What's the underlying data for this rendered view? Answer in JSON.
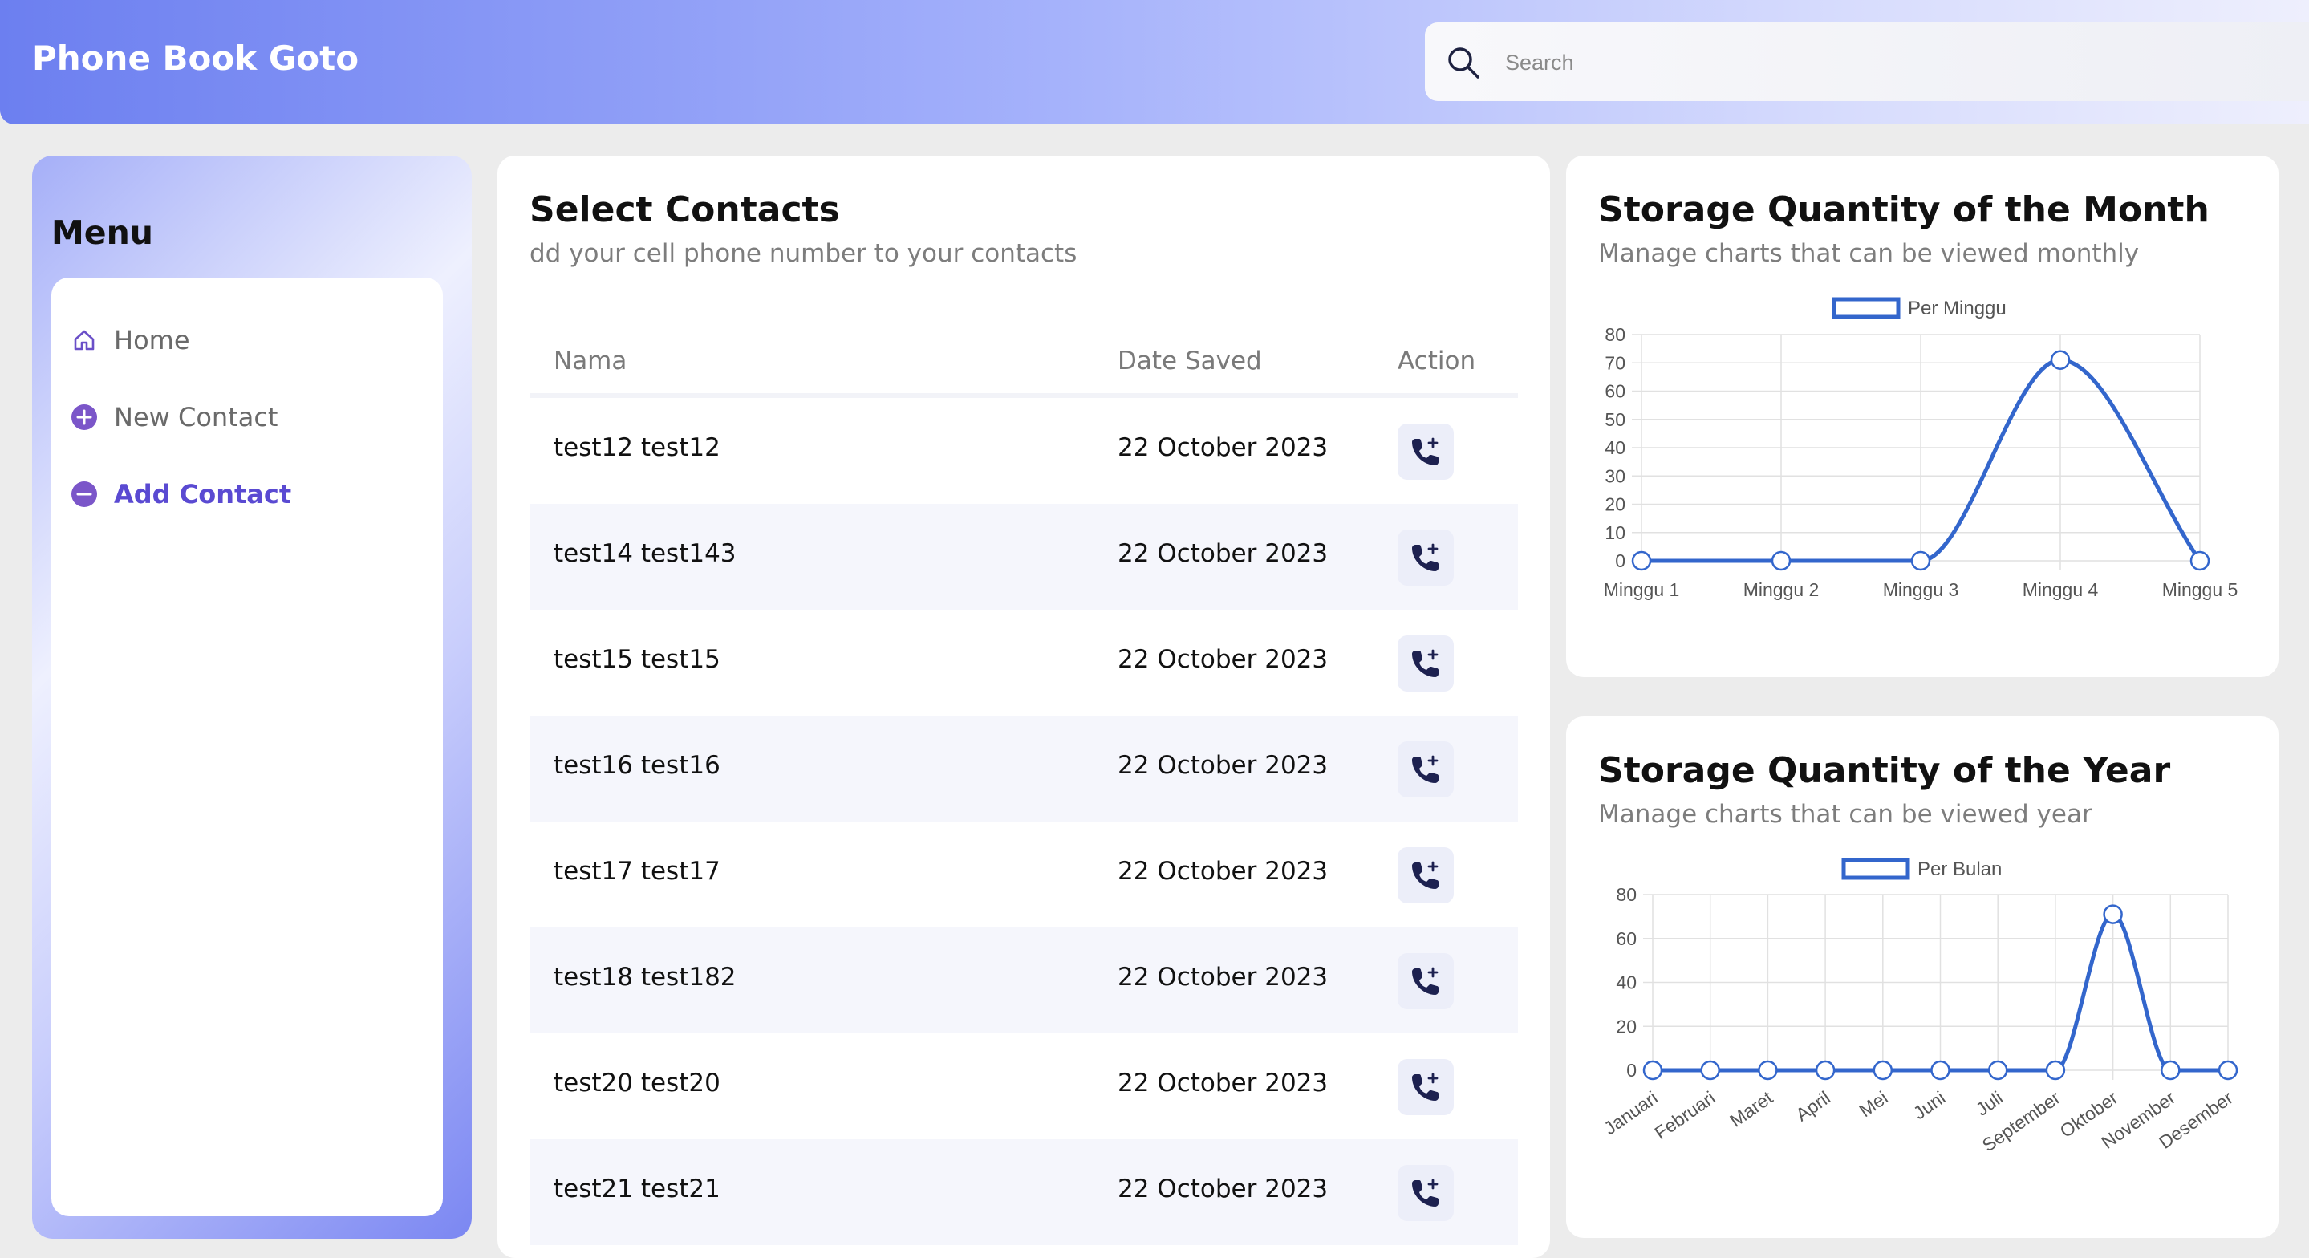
{
  "header": {
    "title": "Phone Book Goto",
    "search_placeholder": "Search"
  },
  "sidebar": {
    "title": "Menu",
    "items": [
      {
        "label": "Home",
        "icon": "home-icon"
      },
      {
        "label": "New Contact",
        "icon": "plus-circle-icon"
      },
      {
        "label": "Add Contact",
        "icon": "minus-circle-icon",
        "active": true
      }
    ]
  },
  "contacts": {
    "title": "Select Contacts",
    "subtitle": "dd your cell phone number to your contacts",
    "columns": [
      "Nama",
      "Date Saved",
      "Action"
    ],
    "rows": [
      {
        "name": "test12 test12",
        "date": "22 October 2023"
      },
      {
        "name": "test14 test143",
        "date": "22 October 2023"
      },
      {
        "name": "test15 test15",
        "date": "22 October 2023"
      },
      {
        "name": "test16 test16",
        "date": "22 October 2023"
      },
      {
        "name": "test17 test17",
        "date": "22 October 2023"
      },
      {
        "name": "test18 test182",
        "date": "22 October 2023"
      },
      {
        "name": "test20 test20",
        "date": "22 October 2023"
      },
      {
        "name": "test21 test21",
        "date": "22 October 2023"
      }
    ]
  },
  "monthly_card": {
    "title": "Storage Quantity of the Month",
    "subtitle": "Manage charts that can be viewed monthly"
  },
  "yearly_card": {
    "title": "Storage Quantity of the Year",
    "subtitle": "Manage charts that can be viewed year"
  },
  "colors": {
    "accent": "#5a4ad2",
    "line": "#3366cc"
  },
  "chart_data": [
    {
      "type": "line",
      "categories": [
        "Minggu 1",
        "Minggu 2",
        "Minggu 3",
        "Minggu 4",
        "Minggu 5"
      ],
      "series": [
        {
          "name": "Per Minggu",
          "values": [
            0,
            0,
            0,
            71,
            0
          ]
        }
      ],
      "ylim": [
        0,
        80
      ],
      "yticks": [
        0,
        10,
        20,
        30,
        40,
        50,
        60,
        70,
        80
      ],
      "legend": "top",
      "grid": true
    },
    {
      "type": "line",
      "categories": [
        "Januari",
        "Februari",
        "Maret",
        "April",
        "Mei",
        "Juni",
        "Juli",
        "September",
        "Oktober",
        "November",
        "Desember"
      ],
      "series": [
        {
          "name": "Per Bulan",
          "values": [
            0,
            0,
            0,
            0,
            0,
            0,
            0,
            0,
            71,
            0,
            0
          ]
        }
      ],
      "ylim": [
        0,
        80
      ],
      "yticks": [
        0,
        20,
        40,
        60,
        80
      ],
      "legend": "top",
      "grid": true
    }
  ]
}
